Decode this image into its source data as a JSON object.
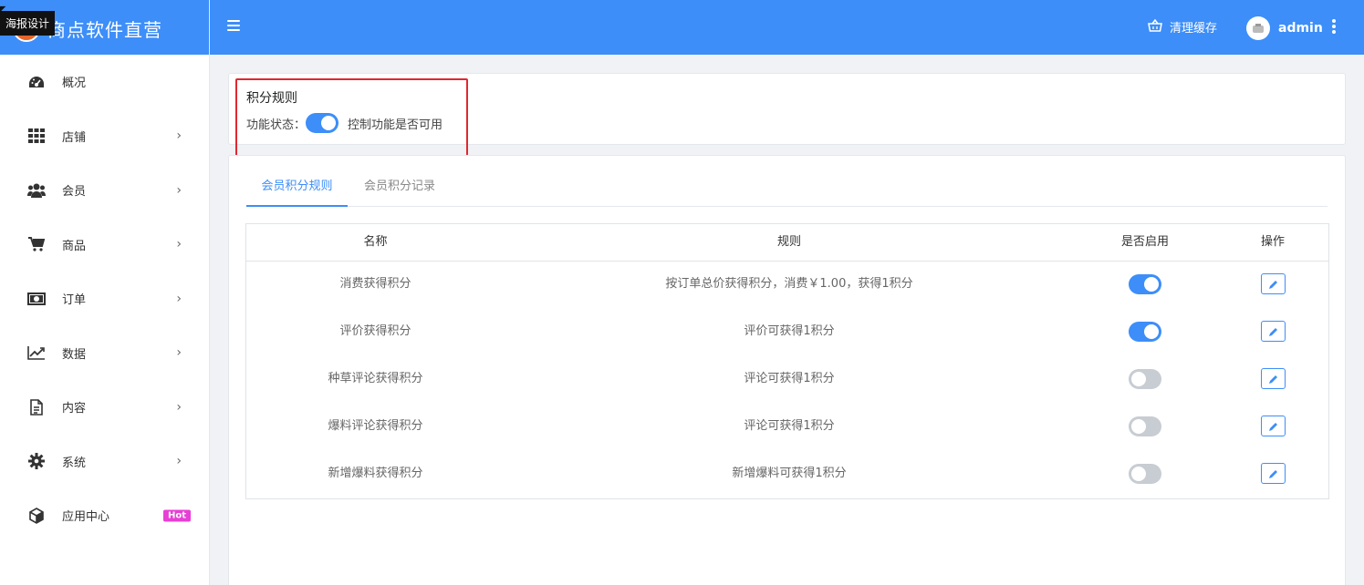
{
  "brand": {
    "title": "商点软件直营",
    "tooltip": "海报设计"
  },
  "sidebar": {
    "items": [
      {
        "label": "概况",
        "icon": "dashboard-icon",
        "has_arrow": false
      },
      {
        "label": "店铺",
        "icon": "grid-icon",
        "has_arrow": true
      },
      {
        "label": "会员",
        "icon": "users-icon",
        "has_arrow": true
      },
      {
        "label": "商品",
        "icon": "cart-icon",
        "has_arrow": true
      },
      {
        "label": "订单",
        "icon": "money-icon",
        "has_arrow": true
      },
      {
        "label": "数据",
        "icon": "chart-icon",
        "has_arrow": true
      },
      {
        "label": "内容",
        "icon": "document-icon",
        "has_arrow": true
      },
      {
        "label": "系统",
        "icon": "gear-icon",
        "has_arrow": true
      },
      {
        "label": "应用中心",
        "icon": "cube-icon",
        "badge": "Hot"
      }
    ]
  },
  "header": {
    "clear_cache": "清理缓存",
    "user_name": "admin"
  },
  "rule_card": {
    "title": "积分规则",
    "status_label": "功能状态：",
    "status_on": true,
    "status_desc": "控制功能是否可用"
  },
  "tabs": [
    {
      "label": "会员积分规则",
      "active": true
    },
    {
      "label": "会员积分记录",
      "active": false
    }
  ],
  "table": {
    "headers": [
      "名称",
      "规则",
      "是否启用",
      "操作"
    ],
    "rows": [
      {
        "name": "消费获得积分",
        "rule": "按订单总价获得积分，消费￥1.00，获得1积分",
        "enabled": true
      },
      {
        "name": "评价获得积分",
        "rule": "评价可获得1积分",
        "enabled": true
      },
      {
        "name": "种草评论获得积分",
        "rule": "评论可获得1积分",
        "enabled": false
      },
      {
        "name": "爆料评论获得积分",
        "rule": "评论可获得1积分",
        "enabled": false
      },
      {
        "name": "新增爆料获得积分",
        "rule": "新增爆料可获得1积分",
        "enabled": false
      }
    ]
  },
  "colors": {
    "primary": "#3d8ef8",
    "highlight": "#e0282f",
    "hot": "#e83fd6"
  }
}
